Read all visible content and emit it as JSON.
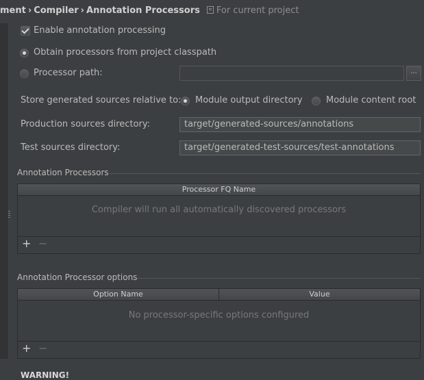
{
  "breadcrumb": {
    "partial": "ment",
    "compiler": "Compiler",
    "annotation_processors": "Annotation Processors",
    "scope": "For current project"
  },
  "enable_processing": {
    "label": "Enable annotation processing",
    "checked": true
  },
  "processor_source": {
    "classpath_label": "Obtain processors from project classpath",
    "path_label": "Processor path:",
    "path_value": "",
    "browse_label": "...",
    "selected": "classpath"
  },
  "store_generated": {
    "label": "Store generated sources relative to:",
    "module_output_label": "Module output directory",
    "module_content_label": "Module content root",
    "selected": "module_output"
  },
  "production_dir": {
    "label": "Production sources directory:",
    "value": "target/generated-sources/annotations"
  },
  "test_dir": {
    "label": "Test sources directory:",
    "value": "target/generated-test-sources/test-annotations"
  },
  "processors_section": {
    "title": "Annotation Processors",
    "column": "Processor FQ Name",
    "empty_text": "Compiler will run all automatically discovered processors",
    "add_label": "+",
    "remove_label": "−"
  },
  "options_section": {
    "title": "Annotation Processor options",
    "columns": [
      "Option Name",
      "Value"
    ],
    "empty_text": "No processor-specific options configured",
    "add_label": "+",
    "remove_label": "−"
  },
  "warning": {
    "label": "WARNING!"
  },
  "colors": {
    "background": "#3c3f41",
    "text": "#bbbbbb",
    "border": "#2b2b2b"
  }
}
